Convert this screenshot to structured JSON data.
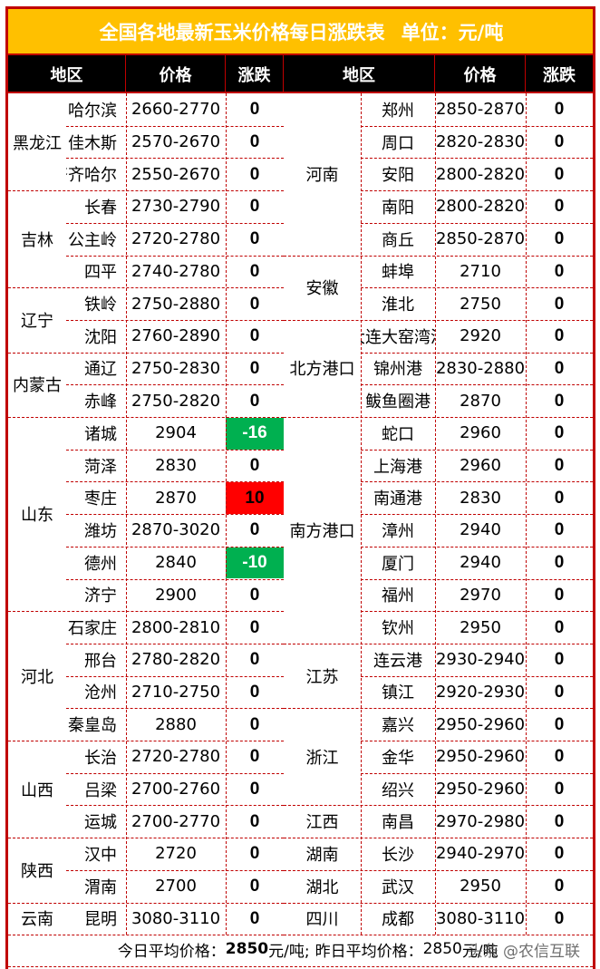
{
  "title": "全国各地最新玉米价格每日涨跌表",
  "unit": "单位：元/吨",
  "headers": {
    "left": [
      "地区",
      "价格",
      "涨跌"
    ],
    "right": [
      "地区",
      "价格",
      "涨跌"
    ]
  },
  "colors": {
    "title_bg": "#ffc000",
    "header_bg": "#000000",
    "border": "#c00000",
    "down": "#00b050",
    "up": "#ff0000"
  },
  "left_groups": [
    {
      "province": "黑龙江",
      "rows": [
        {
          "city": "哈尔滨",
          "price": "2660-2770",
          "change": "0"
        },
        {
          "city": "佳木斯",
          "price": "2570-2670",
          "change": "0"
        },
        {
          "city": "齐齐哈尔",
          "price": "2550-2670",
          "change": "0"
        }
      ]
    },
    {
      "province": "吉林",
      "rows": [
        {
          "city": "长春",
          "price": "2730-2790",
          "change": "0"
        },
        {
          "city": "公主岭",
          "price": "2720-2780",
          "change": "0"
        },
        {
          "city": "四平",
          "price": "2740-2780",
          "change": "0"
        }
      ]
    },
    {
      "province": "辽宁",
      "rows": [
        {
          "city": "铁岭",
          "price": "2750-2880",
          "change": "0"
        },
        {
          "city": "沈阳",
          "price": "2760-2890",
          "change": "0"
        }
      ]
    },
    {
      "province": "内蒙古",
      "rows": [
        {
          "city": "通辽",
          "price": "2750-2830",
          "change": "0"
        },
        {
          "city": "赤峰",
          "price": "2750-2820",
          "change": "0"
        }
      ]
    },
    {
      "province": "山东",
      "rows": [
        {
          "city": "诸城",
          "price": "2904",
          "change": "-16",
          "trend": "down"
        },
        {
          "city": "菏泽",
          "price": "2830",
          "change": "0"
        },
        {
          "city": "枣庄",
          "price": "2870",
          "change": "10",
          "trend": "up"
        },
        {
          "city": "潍坊",
          "price": "2870-3020",
          "change": "0"
        },
        {
          "city": "德州",
          "price": "2840",
          "change": "-10",
          "trend": "down"
        },
        {
          "city": "济宁",
          "price": "2900",
          "change": "0"
        }
      ]
    },
    {
      "province": "河北",
      "rows": [
        {
          "city": "石家庄",
          "price": "2800-2810",
          "change": "0"
        },
        {
          "city": "邢台",
          "price": "2780-2820",
          "change": "0"
        },
        {
          "city": "沧州",
          "price": "2710-2750",
          "change": "0"
        },
        {
          "city": "秦皇岛",
          "price": "2880",
          "change": "0"
        }
      ]
    },
    {
      "province": "山西",
      "rows": [
        {
          "city": "长治",
          "price": "2720-2780",
          "change": "0"
        },
        {
          "city": "吕梁",
          "price": "2700-2760",
          "change": "0"
        },
        {
          "city": "运城",
          "price": "2700-2770",
          "change": "0"
        }
      ]
    },
    {
      "province": "陕西",
      "rows": [
        {
          "city": "汉中",
          "price": "2720",
          "change": "0"
        },
        {
          "city": "渭南",
          "price": "2700",
          "change": "0"
        }
      ]
    },
    {
      "province": "云南",
      "rows": [
        {
          "city": "昆明",
          "price": "3080-3110",
          "change": "0"
        }
      ]
    }
  ],
  "right_groups": [
    {
      "province": "河南",
      "rows": [
        {
          "city": "郑州",
          "price": "2850-2870",
          "change": "0"
        },
        {
          "city": "周口",
          "price": "2820-2830",
          "change": "0"
        },
        {
          "city": "安阳",
          "price": "2800-2820",
          "change": "0"
        },
        {
          "city": "南阳",
          "price": "2800-2820",
          "change": "0"
        },
        {
          "city": "商丘",
          "price": "2850-2870",
          "change": "0"
        }
      ]
    },
    {
      "province": "安徽",
      "rows": [
        {
          "city": "蚌埠",
          "price": "2710",
          "change": "0"
        },
        {
          "city": "淮北",
          "price": "2750",
          "change": "0"
        }
      ]
    },
    {
      "province": "北方港口",
      "rows": [
        {
          "city": "大连大窑湾港",
          "price": "2920",
          "change": "0"
        },
        {
          "city": "锦州港",
          "price": "2830-2880",
          "change": "0"
        },
        {
          "city": "鲅鱼圈港",
          "price": "2870",
          "change": "0"
        }
      ]
    },
    {
      "province": "南方港口",
      "rows": [
        {
          "city": "蛇口",
          "price": "2960",
          "change": "0"
        },
        {
          "city": "上海港",
          "price": "2960",
          "change": "0"
        },
        {
          "city": "南通港",
          "price": "2830",
          "change": "0"
        },
        {
          "city": "漳州",
          "price": "2940",
          "change": "0"
        },
        {
          "city": "厦门",
          "price": "2940",
          "change": "0"
        },
        {
          "city": "福州",
          "price": "2970",
          "change": "0"
        },
        {
          "city": "钦州",
          "price": "2950",
          "change": "0"
        }
      ]
    },
    {
      "province": "江苏",
      "rows": [
        {
          "city": "连云港",
          "price": "2930-2940",
          "change": "0"
        },
        {
          "city": "镇江",
          "price": "2920-2930",
          "change": "0"
        }
      ]
    },
    {
      "province": "浙江",
      "rows": [
        {
          "city": "嘉兴",
          "price": "2950-2960",
          "change": "0"
        },
        {
          "city": "金华",
          "price": "2950-2960",
          "change": "0"
        },
        {
          "city": "绍兴",
          "price": "2950-2960",
          "change": "0"
        }
      ]
    },
    {
      "province": "江西",
      "rows": [
        {
          "city": "南昌",
          "price": "2970-2980",
          "change": "0"
        }
      ]
    },
    {
      "province": "湖南",
      "rows": [
        {
          "city": "长沙",
          "price": "2940-2970",
          "change": "0"
        }
      ]
    },
    {
      "province": "湖北",
      "rows": [
        {
          "city": "武汉",
          "price": "2950",
          "change": "0"
        }
      ]
    },
    {
      "province": "四川",
      "rows": [
        {
          "city": "成都",
          "price": "3080-3110",
          "change": "0"
        }
      ]
    }
  ],
  "footer": {
    "today_label": "今日平均价格：",
    "today_value": "2850",
    "today_unit": "元/吨;",
    "yesterday_label": "昨日平均价格：",
    "yesterday_value": "2850",
    "yesterday_unit": "元/吨",
    "watermark": "头条 @农信互联"
  }
}
